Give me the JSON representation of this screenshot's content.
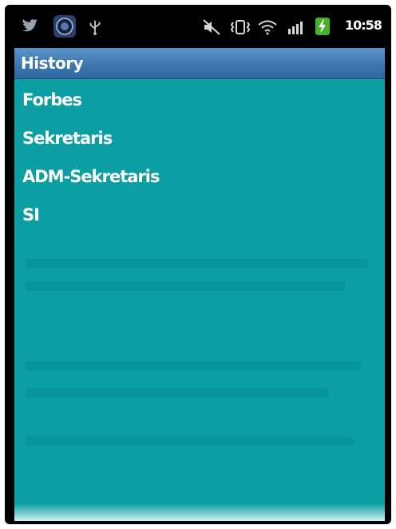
{
  "status_bar": {
    "time": "10:58",
    "icons": [
      "twitter-icon",
      "camera-icon",
      "usb-icon",
      "mute-icon",
      "vibrate-icon",
      "wifi-icon",
      "signal-icon",
      "battery-charging-icon"
    ]
  },
  "title_bar": {
    "title": "History"
  },
  "history": {
    "items": [
      {
        "label": "Forbes"
      },
      {
        "label": "Sekretaris"
      },
      {
        "label": "ADM-Sekretaris"
      },
      {
        "label": "SI"
      }
    ]
  },
  "colors": {
    "background": "#0b9ea3",
    "title_bar": "#3f78b1",
    "text": "#ffffff"
  }
}
